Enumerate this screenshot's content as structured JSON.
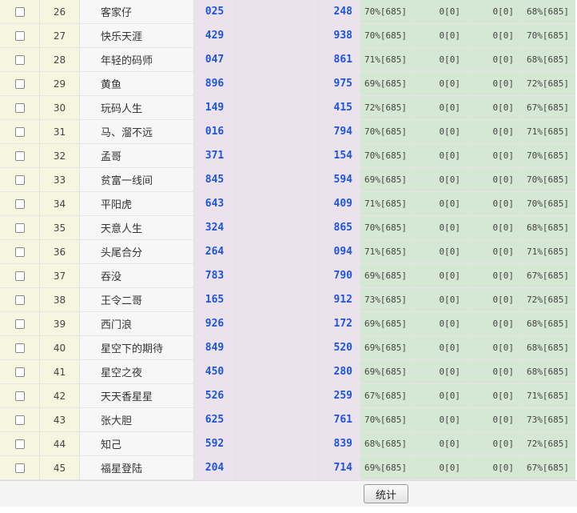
{
  "rows": [
    {
      "no": "26",
      "name": "客家仔",
      "a": "025",
      "b": "248",
      "g1": "70%[685]",
      "g2": "0[0]",
      "g3": "0[0]",
      "g4": "68%[685]"
    },
    {
      "no": "27",
      "name": "快乐天涯",
      "a": "429",
      "b": "938",
      "g1": "70%[685]",
      "g2": "0[0]",
      "g3": "0[0]",
      "g4": "70%[685]"
    },
    {
      "no": "28",
      "name": "年轻的码师",
      "a": "047",
      "b": "861",
      "g1": "71%[685]",
      "g2": "0[0]",
      "g3": "0[0]",
      "g4": "68%[685]"
    },
    {
      "no": "29",
      "name": "黄鱼",
      "a": "896",
      "b": "975",
      "g1": "69%[685]",
      "g2": "0[0]",
      "g3": "0[0]",
      "g4": "72%[685]"
    },
    {
      "no": "30",
      "name": "玩码人生",
      "a": "149",
      "b": "415",
      "g1": "72%[685]",
      "g2": "0[0]",
      "g3": "0[0]",
      "g4": "67%[685]"
    },
    {
      "no": "31",
      "name": "马、溜不远",
      "a": "016",
      "b": "794",
      "g1": "70%[685]",
      "g2": "0[0]",
      "g3": "0[0]",
      "g4": "71%[685]"
    },
    {
      "no": "32",
      "name": "孟哥",
      "a": "371",
      "b": "154",
      "g1": "70%[685]",
      "g2": "0[0]",
      "g3": "0[0]",
      "g4": "70%[685]"
    },
    {
      "no": "33",
      "name": "贫富一线间",
      "a": "845",
      "b": "594",
      "g1": "69%[685]",
      "g2": "0[0]",
      "g3": "0[0]",
      "g4": "70%[685]"
    },
    {
      "no": "34",
      "name": "平阳虎",
      "a": "643",
      "b": "409",
      "g1": "71%[685]",
      "g2": "0[0]",
      "g3": "0[0]",
      "g4": "70%[685]"
    },
    {
      "no": "35",
      "name": "天意人生",
      "a": "324",
      "b": "865",
      "g1": "70%[685]",
      "g2": "0[0]",
      "g3": "0[0]",
      "g4": "68%[685]"
    },
    {
      "no": "36",
      "name": "头尾合分",
      "a": "264",
      "b": "094",
      "g1": "71%[685]",
      "g2": "0[0]",
      "g3": "0[0]",
      "g4": "71%[685]"
    },
    {
      "no": "37",
      "name": "吞没",
      "a": "783",
      "b": "790",
      "g1": "69%[685]",
      "g2": "0[0]",
      "g3": "0[0]",
      "g4": "67%[685]"
    },
    {
      "no": "38",
      "name": "王令二哥",
      "a": "165",
      "b": "912",
      "g1": "73%[685]",
      "g2": "0[0]",
      "g3": "0[0]",
      "g4": "72%[685]"
    },
    {
      "no": "39",
      "name": "西门浪",
      "a": "926",
      "b": "172",
      "g1": "69%[685]",
      "g2": "0[0]",
      "g3": "0[0]",
      "g4": "68%[685]"
    },
    {
      "no": "40",
      "name": "星空下的期待",
      "a": "849",
      "b": "520",
      "g1": "69%[685]",
      "g2": "0[0]",
      "g3": "0[0]",
      "g4": "68%[685]"
    },
    {
      "no": "41",
      "name": "星空之夜",
      "a": "450",
      "b": "280",
      "g1": "69%[685]",
      "g2": "0[0]",
      "g3": "0[0]",
      "g4": "68%[685]"
    },
    {
      "no": "42",
      "name": "天天香星星",
      "a": "526",
      "b": "259",
      "g1": "67%[685]",
      "g2": "0[0]",
      "g3": "0[0]",
      "g4": "71%[685]"
    },
    {
      "no": "43",
      "name": "张大胆",
      "a": "625",
      "b": "761",
      "g1": "70%[685]",
      "g2": "0[0]",
      "g3": "0[0]",
      "g4": "73%[685]"
    },
    {
      "no": "44",
      "name": "知己",
      "a": "592",
      "b": "839",
      "g1": "68%[685]",
      "g2": "0[0]",
      "g3": "0[0]",
      "g4": "72%[685]"
    },
    {
      "no": "45",
      "name": "福星登陆",
      "a": "204",
      "b": "714",
      "g1": "69%[685]",
      "g2": "0[0]",
      "g3": "0[0]",
      "g4": "67%[685]"
    }
  ],
  "footer": {
    "stat_button_label": "统计"
  }
}
